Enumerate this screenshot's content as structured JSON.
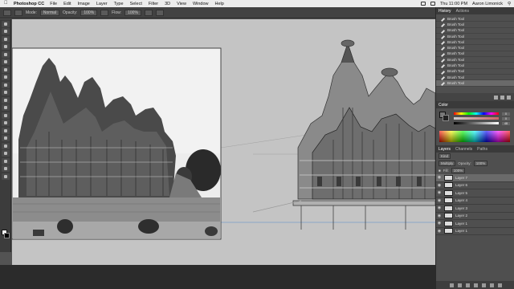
{
  "menubar": {
    "app": "Photoshop CC",
    "items": [
      "File",
      "Edit",
      "Image",
      "Layer",
      "Type",
      "Select",
      "Filter",
      "3D",
      "View",
      "Window",
      "Help"
    ],
    "clock": "Thu 11:00 PM",
    "user": "Aaron Limonick"
  },
  "options": {
    "mode_label": "Mode:",
    "mode_value": "Normal",
    "opacity_label": "Opacity:",
    "opacity_value": "100%",
    "flow_label": "Flow:",
    "flow_value": "100%"
  },
  "history": {
    "tabs": [
      "History",
      "Actions"
    ],
    "items": [
      "Brush Tool",
      "Brush Tool",
      "Brush Tool",
      "Brush Tool",
      "Brush Tool",
      "Brush Tool",
      "Brush Tool",
      "Brush Tool",
      "Brush Tool",
      "Brush Tool",
      "Brush Tool",
      "Brush Tool"
    ]
  },
  "color": {
    "title": "Color",
    "values": [
      "0",
      "0",
      "48"
    ]
  },
  "layers": {
    "tabs": [
      "Layers",
      "Channels",
      "Paths"
    ],
    "kind": "Kind",
    "blend": "Multiply",
    "opacity_label": "Opacity:",
    "opacity": "100%",
    "fill_label": "Fill:",
    "fill": "100%",
    "items": [
      "Layer 7",
      "Layer 6",
      "Layer 5",
      "Layer 4",
      "Layer 3",
      "Layer 2",
      "Layer 1",
      "Layer 1"
    ]
  }
}
